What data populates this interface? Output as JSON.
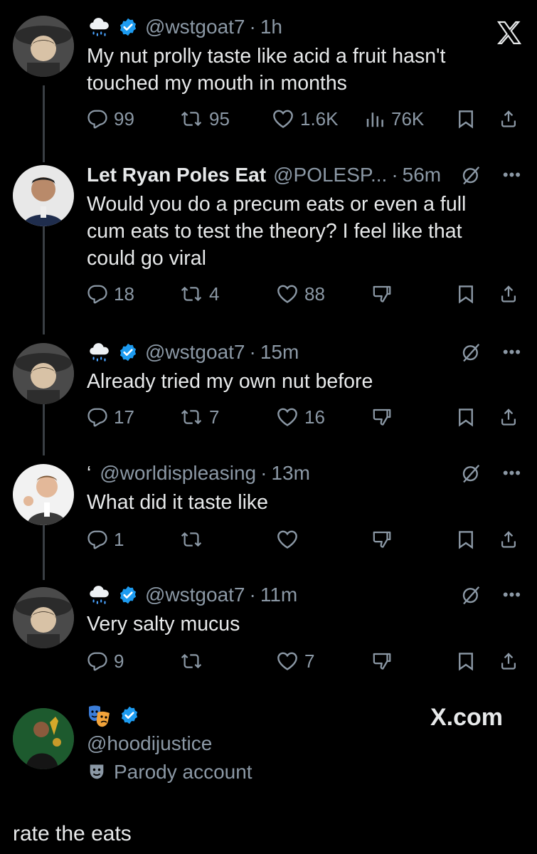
{
  "tweets": [
    {
      "handle": "@wstgoat7",
      "time": "1h",
      "text": "My nut prolly taste like acid a fruit hasn't touched my mouth in months",
      "replies": "99",
      "retweets": "95",
      "likes": "1.6K",
      "views": "76K"
    },
    {
      "name": "Let Ryan Poles Eat",
      "handle": "@POLESP...",
      "time": "56m",
      "text": "Would you do a precum eats or even a full cum eats to test the theory? I feel like that could go viral",
      "replies": "18",
      "retweets": "4",
      "likes": "88"
    },
    {
      "handle": "@wstgoat7",
      "time": "15m",
      "text": "Already tried my own nut before",
      "replies": "17",
      "retweets": "7",
      "likes": "16"
    },
    {
      "prefix": "‘",
      "handle": "@worldispleasing",
      "time": "13m",
      "text": "What did it taste like",
      "replies": "1",
      "retweets": "",
      "likes": ""
    },
    {
      "handle": "@wstgoat7",
      "time": "11m",
      "text": "Very salty mucus",
      "replies": "9",
      "retweets": "",
      "likes": "7"
    }
  ],
  "source": {
    "handle": "@hoodijustice",
    "badge": "Parody account",
    "site": "X.com"
  },
  "caption": "rate the eats",
  "colors": {
    "verified": "#1d9bf0",
    "muted": "#8b98a5",
    "text": "#e7e9ea"
  },
  "icons": [
    "x-logo-icon",
    "verified-icon",
    "reply-icon",
    "retweet-icon",
    "like-icon",
    "views-icon",
    "bookmark-icon",
    "share-icon",
    "downvote-icon",
    "grok-icon",
    "more-icon"
  ]
}
